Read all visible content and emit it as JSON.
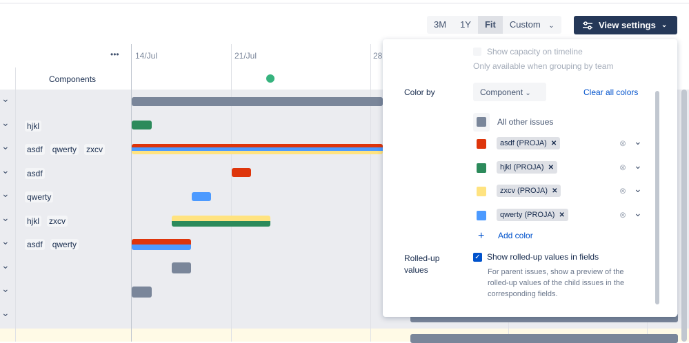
{
  "toolbar": {
    "ranges": [
      "3M",
      "1Y",
      "Fit",
      "Custom"
    ],
    "active": "Fit",
    "view_settings": "View settings"
  },
  "timeline": {
    "more": "•••",
    "column_header": "Components",
    "dates": [
      "14/Jul",
      "21/Jul",
      "28"
    ]
  },
  "rows": [
    {
      "tags": []
    },
    {
      "tags": [
        "hjkl"
      ]
    },
    {
      "tags": [
        "asdf",
        "qwerty",
        "zxcv"
      ]
    },
    {
      "tags": [
        "asdf"
      ]
    },
    {
      "tags": [
        "qwerty"
      ]
    },
    {
      "tags": [
        "hjkl",
        "zxcv"
      ]
    },
    {
      "tags": [
        "asdf",
        "qwerty"
      ]
    },
    {
      "tags": []
    },
    {
      "tags": []
    },
    {
      "tags": []
    }
  ],
  "colors": {
    "gray": "#7a869a",
    "red": "#de350b",
    "green": "#2c8a5b",
    "yellow": "#ffe380",
    "blue": "#4c9aff",
    "navy": "#253858",
    "link": "#0052cc"
  },
  "panel": {
    "capacity_label": "Show capacity on timeline",
    "capacity_help": "Only available when grouping by team",
    "color_by_label": "Color by",
    "color_by_value": "Component",
    "clear_all": "Clear all colors",
    "all_other": "All other issues",
    "color_rules": [
      {
        "name": "asdf (PROJA)",
        "color": "#de350b"
      },
      {
        "name": "hjkl (PROJA)",
        "color": "#2c8a5b"
      },
      {
        "name": "zxcv (PROJA)",
        "color": "#ffe380"
      },
      {
        "name": "qwerty (PROJA)",
        "color": "#4c9aff"
      }
    ],
    "add_color": "Add color",
    "rolled_label": "Rolled-up values",
    "rolled_checkbox": "Show rolled-up values in fields",
    "rolled_checked": true,
    "rolled_help": "For parent issues, show a preview of the rolled-up values of the child issues in the corresponding fields."
  }
}
